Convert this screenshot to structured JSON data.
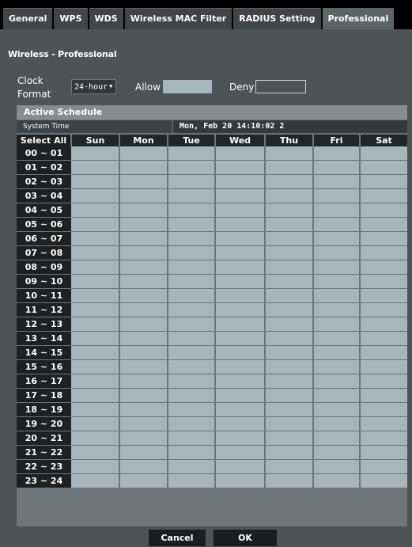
{
  "tabs": [
    "General",
    "WPS",
    "WDS",
    "Wireless MAC Filter",
    "RADIUS Setting",
    "Professional"
  ],
  "active_tab": "Professional",
  "page_title": "Wireless - Professional",
  "clock": {
    "label_line1": "Clock",
    "label_line2": "Format",
    "value": "24-hour"
  },
  "legend": {
    "allow": "Allow",
    "deny": "Deny",
    "allow_color": "#a6b6bb"
  },
  "schedule": {
    "header": "Active Schedule",
    "system_time_label": "System Time",
    "system_time_value": "Mon, Feb 20 14:10:02 2",
    "select_all": "Select All",
    "days": [
      "Sun",
      "Mon",
      "Tue",
      "Wed",
      "Thu",
      "Fri",
      "Sat"
    ],
    "hours": [
      "00 ~ 01",
      "01 ~ 02",
      "02 ~ 03",
      "03 ~ 04",
      "04 ~ 05",
      "05 ~ 06",
      "06 ~ 07",
      "07 ~ 08",
      "08 ~ 09",
      "09 ~ 10",
      "10 ~ 11",
      "11 ~ 12",
      "12 ~ 13",
      "13 ~ 14",
      "14 ~ 15",
      "15 ~ 16",
      "16 ~ 17",
      "17 ~ 18",
      "18 ~ 19",
      "19 ~ 20",
      "20 ~ 21",
      "21 ~ 22",
      "22 ~ 23",
      "23 ~ 24"
    ],
    "all_cells_allowed": true
  },
  "buttons": {
    "cancel": "Cancel",
    "ok": "OK"
  }
}
